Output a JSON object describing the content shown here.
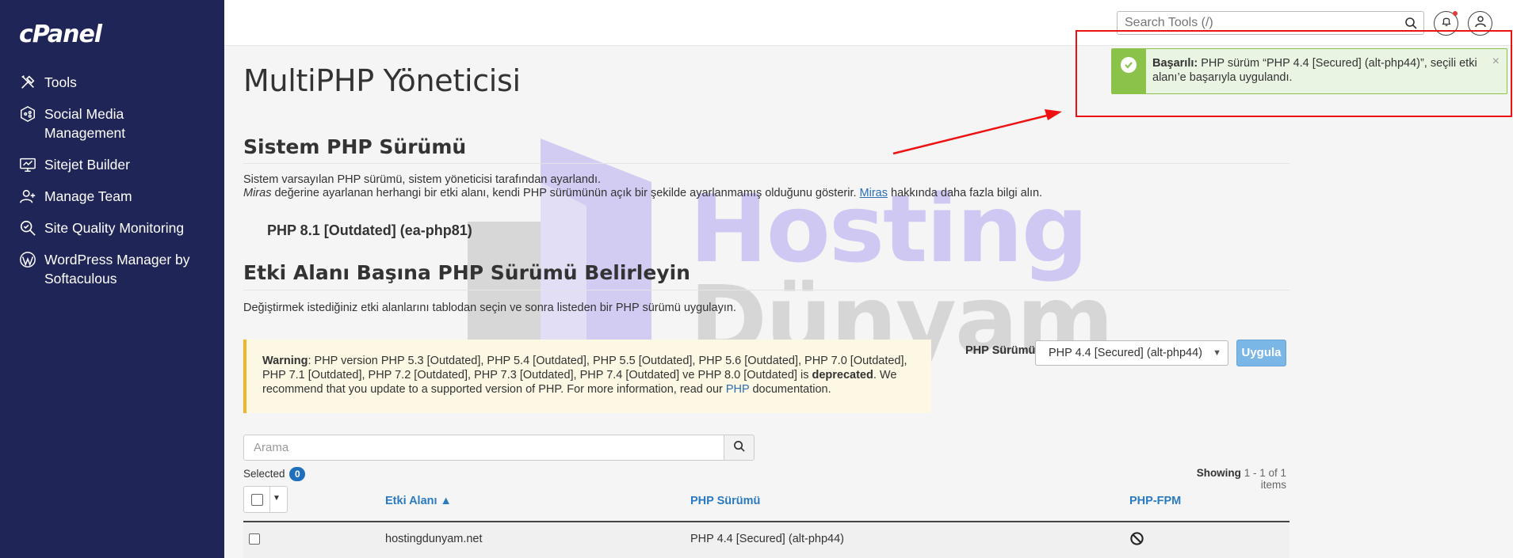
{
  "sidebar": {
    "logo": "cPanel",
    "items": [
      {
        "label": "Tools",
        "icon": "tools-icon"
      },
      {
        "label": "Social Media Management",
        "icon": "social-media-icon"
      },
      {
        "label": "Sitejet Builder",
        "icon": "monitor-icon"
      },
      {
        "label": "Manage Team",
        "icon": "team-icon"
      },
      {
        "label": "Site Quality Monitoring",
        "icon": "magnifier-icon"
      },
      {
        "label": "WordPress Manager by Softaculous",
        "icon": "wordpress-icon"
      }
    ]
  },
  "header": {
    "search_placeholder": "Search Tools (/)"
  },
  "main": {
    "title": "MultiPHP Yöneticisi",
    "system_section": {
      "title": "Sistem PHP Sürümü",
      "line1": "Sistem varsayılan PHP sürümü, sistem yöneticisi tarafından ayarlandı.",
      "line2_em": "Miras",
      "line2_mid": " değerine ayarlanan herhangi bir etki alanı, kendi PHP sürümünün açık bir şekilde ayarlanmamış olduğunu gösterir. ",
      "line2_link": "Miras",
      "line2_end": " hakkında daha fazla bilgi alın.",
      "current_version": "PHP 8.1 [Outdated] (ea-php81)"
    },
    "domain_section": {
      "title": "Etki Alanı Başına PHP Sürümü Belirleyin",
      "description": "Değiştirmek istediğiniz etki alanlarını tablodan seçin ve sonra listeden bir PHP sürümü uygulayın."
    },
    "warning": {
      "label": "Warning",
      "text1": ": PHP version PHP 5.3 [Outdated], PHP 5.4 [Outdated], PHP 5.5 [Outdated], PHP 5.6 [Outdated], PHP 7.0 [Outdated], PHP 7.1 [Outdated], PHP 7.2 [Outdated], PHP 7.3 [Outdated], PHP 7.4 [Outdated] ve PHP 8.0 [Outdated] is ",
      "bold": "deprecated",
      "text2": ". We recommend that you update to a supported version of PHP. For more information, read our ",
      "link": "PHP",
      "text3": " documentation."
    },
    "php_version_label": "PHP Sürümü",
    "php_version_selected": "PHP 4.4 [Secured] (alt-php44)",
    "apply_label": "Uygula",
    "filter_placeholder": "Arama",
    "selected_label": "Selected",
    "selected_count": "0",
    "showing_label": "Showing",
    "showing_range": "1 - 1 of 1 items",
    "table": {
      "headers": [
        "Etki Alanı ▲",
        "PHP Sürümü",
        "PHP-FPM"
      ],
      "rows": [
        {
          "domain": "hostingdunyam.net",
          "php": "PHP 4.4 [Secured] (alt-php44)",
          "fpm_icon": "disabled-icon"
        }
      ]
    }
  },
  "toast": {
    "label": "Başarılı:",
    "message": " PHP sürüm “PHP 4.4 [Secured] (alt-php44)”, seçili etki alanı’e başarıyla uygulandı.",
    "close": "×"
  },
  "watermark": {
    "line1": "Hosting",
    "line2": "Dünyam"
  },
  "colors": {
    "sidebar_bg": "#1f2556",
    "success": "#8bc34a",
    "link": "#2a7ac0",
    "annotation": "#ee1111"
  }
}
